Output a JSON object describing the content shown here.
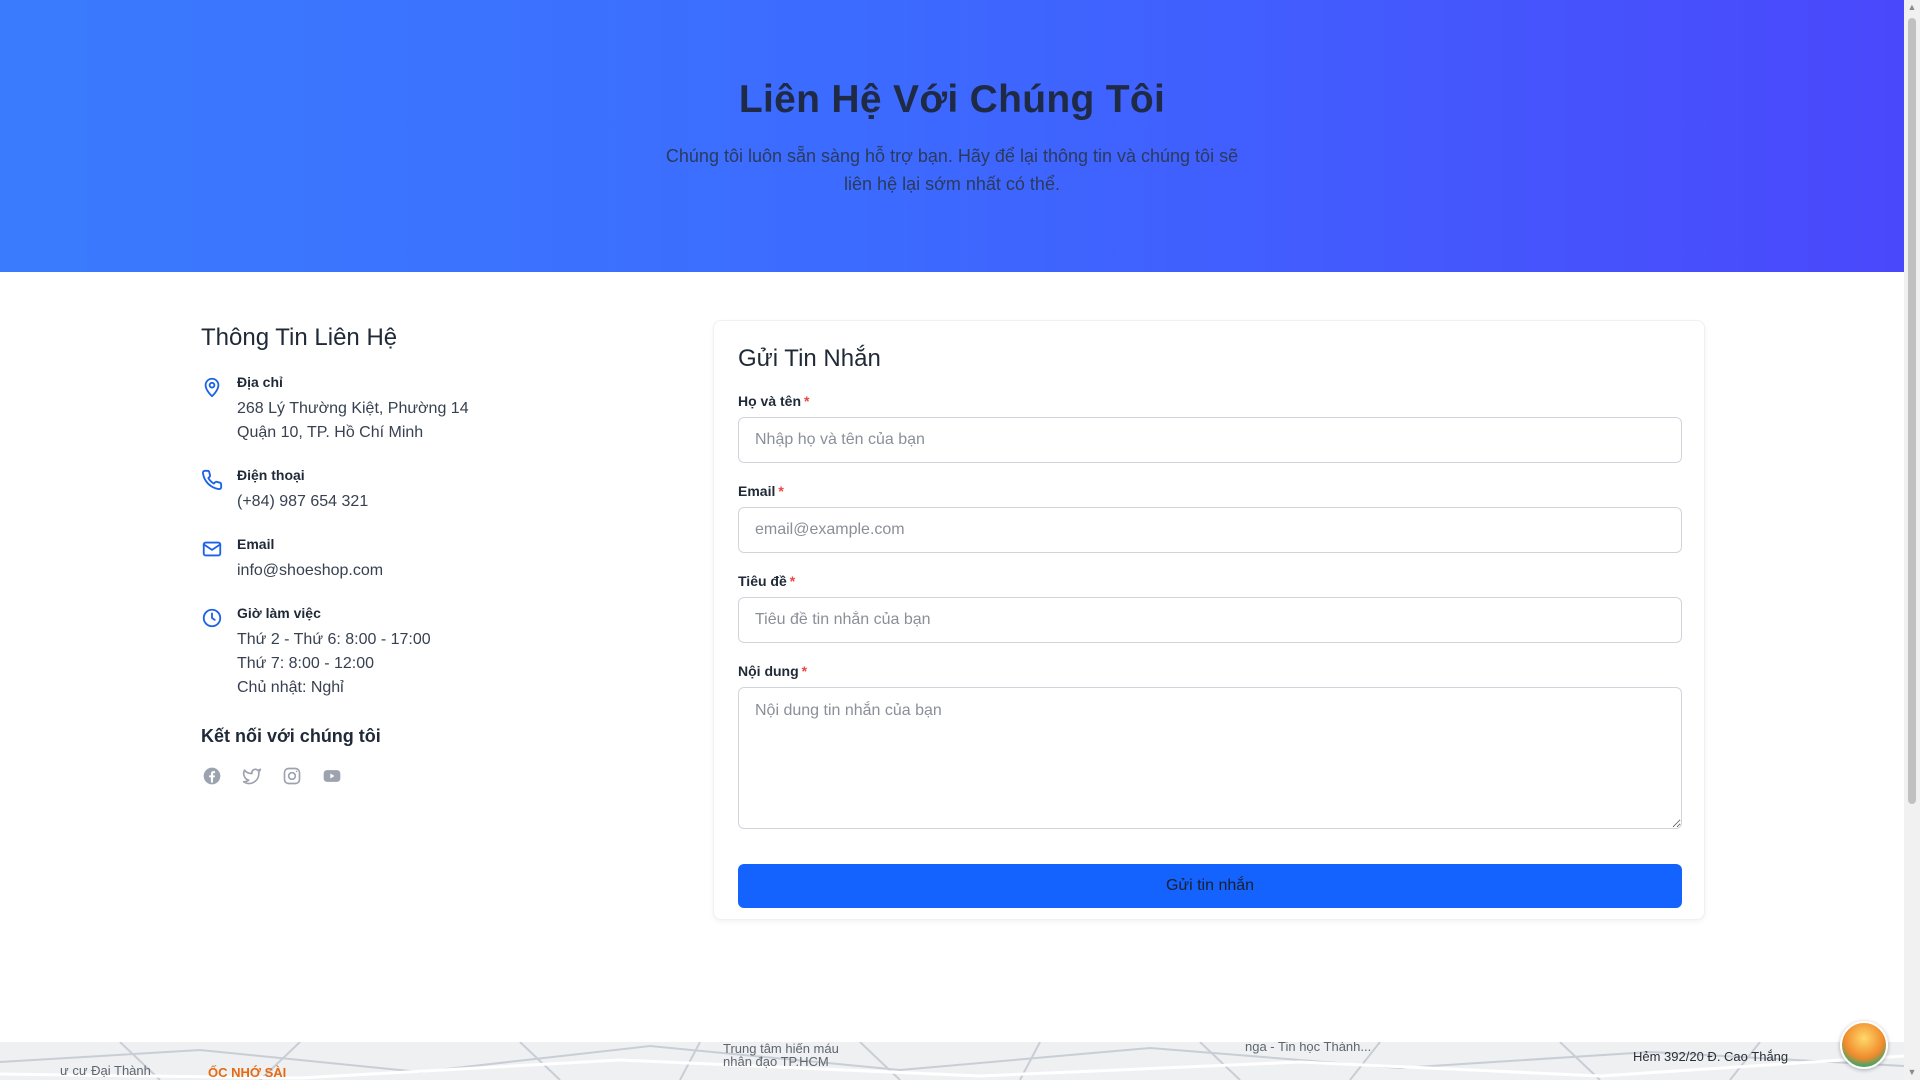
{
  "hero": {
    "title": "Liên Hệ Với Chúng Tôi",
    "subtitle": "Chúng tôi luôn sẵn sàng hỗ trợ bạn. Hãy để lại thông tin và chúng tôi sẽ liên hệ lại sớm nhất có thể."
  },
  "info": {
    "heading": "Thông Tin Liên Hệ",
    "address": {
      "label": "Địa chỉ",
      "line1": "268 Lý Thường Kiệt, Phường 14",
      "line2": "Quận 10, TP. Hồ Chí Minh"
    },
    "phone": {
      "label": "Điện thoại",
      "value": "(+84) 987 654 321"
    },
    "email": {
      "label": "Email",
      "value": "info@shoeshop.com"
    },
    "hours": {
      "label": "Giờ làm việc",
      "line1": "Thứ 2 - Thứ 6: 8:00 - 17:00",
      "line2": "Thứ 7: 8:00 - 12:00",
      "line3": "Chủ nhật: Nghỉ"
    },
    "social_heading": "Kết nối với chúng tôi",
    "socials": [
      "facebook-icon",
      "twitter-icon",
      "instagram-icon",
      "youtube-icon"
    ]
  },
  "form": {
    "heading": "Gửi Tin Nhắn",
    "required_mark": "*",
    "name": {
      "label": "Họ và tên",
      "placeholder": "Nhập họ và tên của bạn",
      "value": ""
    },
    "email": {
      "label": "Email",
      "placeholder": "email@example.com",
      "value": ""
    },
    "subject": {
      "label": "Tiêu đề",
      "placeholder": "Tiêu đề tin nhắn của bạn",
      "value": ""
    },
    "message": {
      "label": "Nội dung",
      "placeholder": "Nội dung tin nhắn của bạn",
      "value": ""
    },
    "submit_label": "Gửi tin nhắn"
  },
  "map": {
    "labels": [
      "Hẻm 392/20 Đ. Cao Thắng",
      "Trung tâm hiến máu",
      "nhân đạo TP.HCM",
      "ư cư Đại Thành",
      "ỐC NHỚ SÀI",
      "nga - Tin học Thành..."
    ]
  },
  "colors": {
    "hero_gradient_start": "#3a7bfd",
    "hero_gradient_end": "#4a48fb",
    "accent": "#1463ff",
    "icon_blue": "#1d63e8",
    "required": "#ef4444"
  }
}
